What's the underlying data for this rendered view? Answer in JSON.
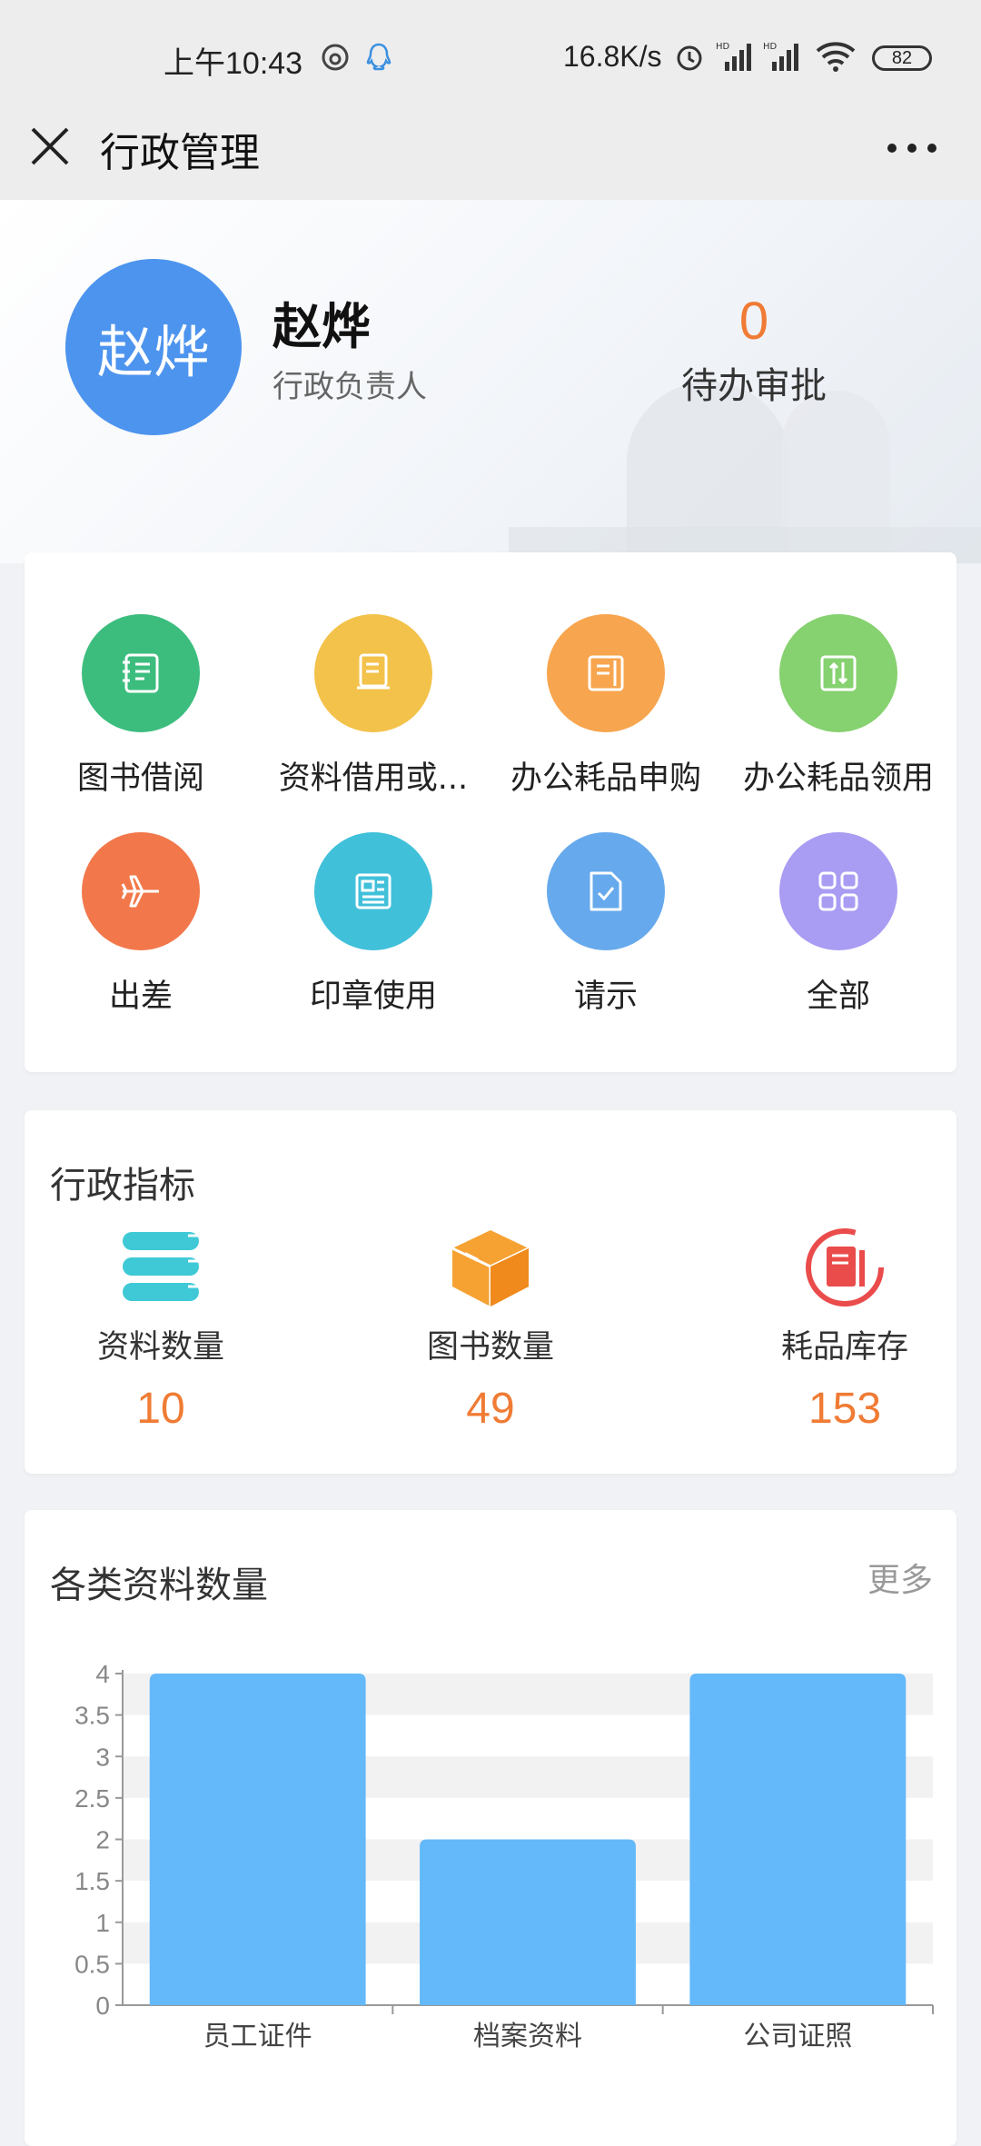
{
  "status_bar": {
    "time": "上午10:43",
    "net_speed": "16.8K/s",
    "battery": "82"
  },
  "nav": {
    "title": "行政管理"
  },
  "profile": {
    "avatar_text": "赵烨",
    "name": "赵烨",
    "role": "行政负责人",
    "pending_count": "0",
    "pending_label": "待办审批"
  },
  "shortcuts": [
    {
      "label": "图书借阅",
      "icon": "book-icon",
      "color": "#3cbd7e"
    },
    {
      "label": "资料借用或...",
      "icon": "document-tray-icon",
      "color": "#f3c24a"
    },
    {
      "label": "办公耗品申购",
      "icon": "purchase-form-icon",
      "color": "#f7a54e"
    },
    {
      "label": "办公耗品领用",
      "icon": "transfer-icon",
      "color": "#86d170"
    },
    {
      "label": "出差",
      "icon": "airplane-icon",
      "color": "#f2784b"
    },
    {
      "label": "印章使用",
      "icon": "newspaper-icon",
      "color": "#41c0da"
    },
    {
      "label": "请示",
      "icon": "check-document-icon",
      "color": "#66a9ec"
    },
    {
      "label": "全部",
      "icon": "grid-icon",
      "color": "#a99cf3"
    }
  ],
  "metrics": {
    "title": "行政指标",
    "items": [
      {
        "label": "资料数量",
        "value": "10",
        "icon": "books-stack-icon"
      },
      {
        "label": "图书数量",
        "value": "49",
        "icon": "box-icon"
      },
      {
        "label": "耗品库存",
        "value": "153",
        "icon": "inventory-book-icon"
      }
    ]
  },
  "chart_section": {
    "title": "各类资料数量",
    "more": "更多"
  },
  "chart_data": {
    "type": "bar",
    "title": "各类资料数量",
    "categories": [
      "员工证件",
      "档案资料",
      "公司证照"
    ],
    "values": [
      4,
      2,
      4
    ],
    "ylim": [
      0,
      4
    ],
    "yticks": [
      "0",
      "0.5",
      "1",
      "1.5",
      "2",
      "2.5",
      "3",
      "3.5",
      "4"
    ],
    "bar_color": "#63b9fa",
    "grid": "alternating bands"
  }
}
